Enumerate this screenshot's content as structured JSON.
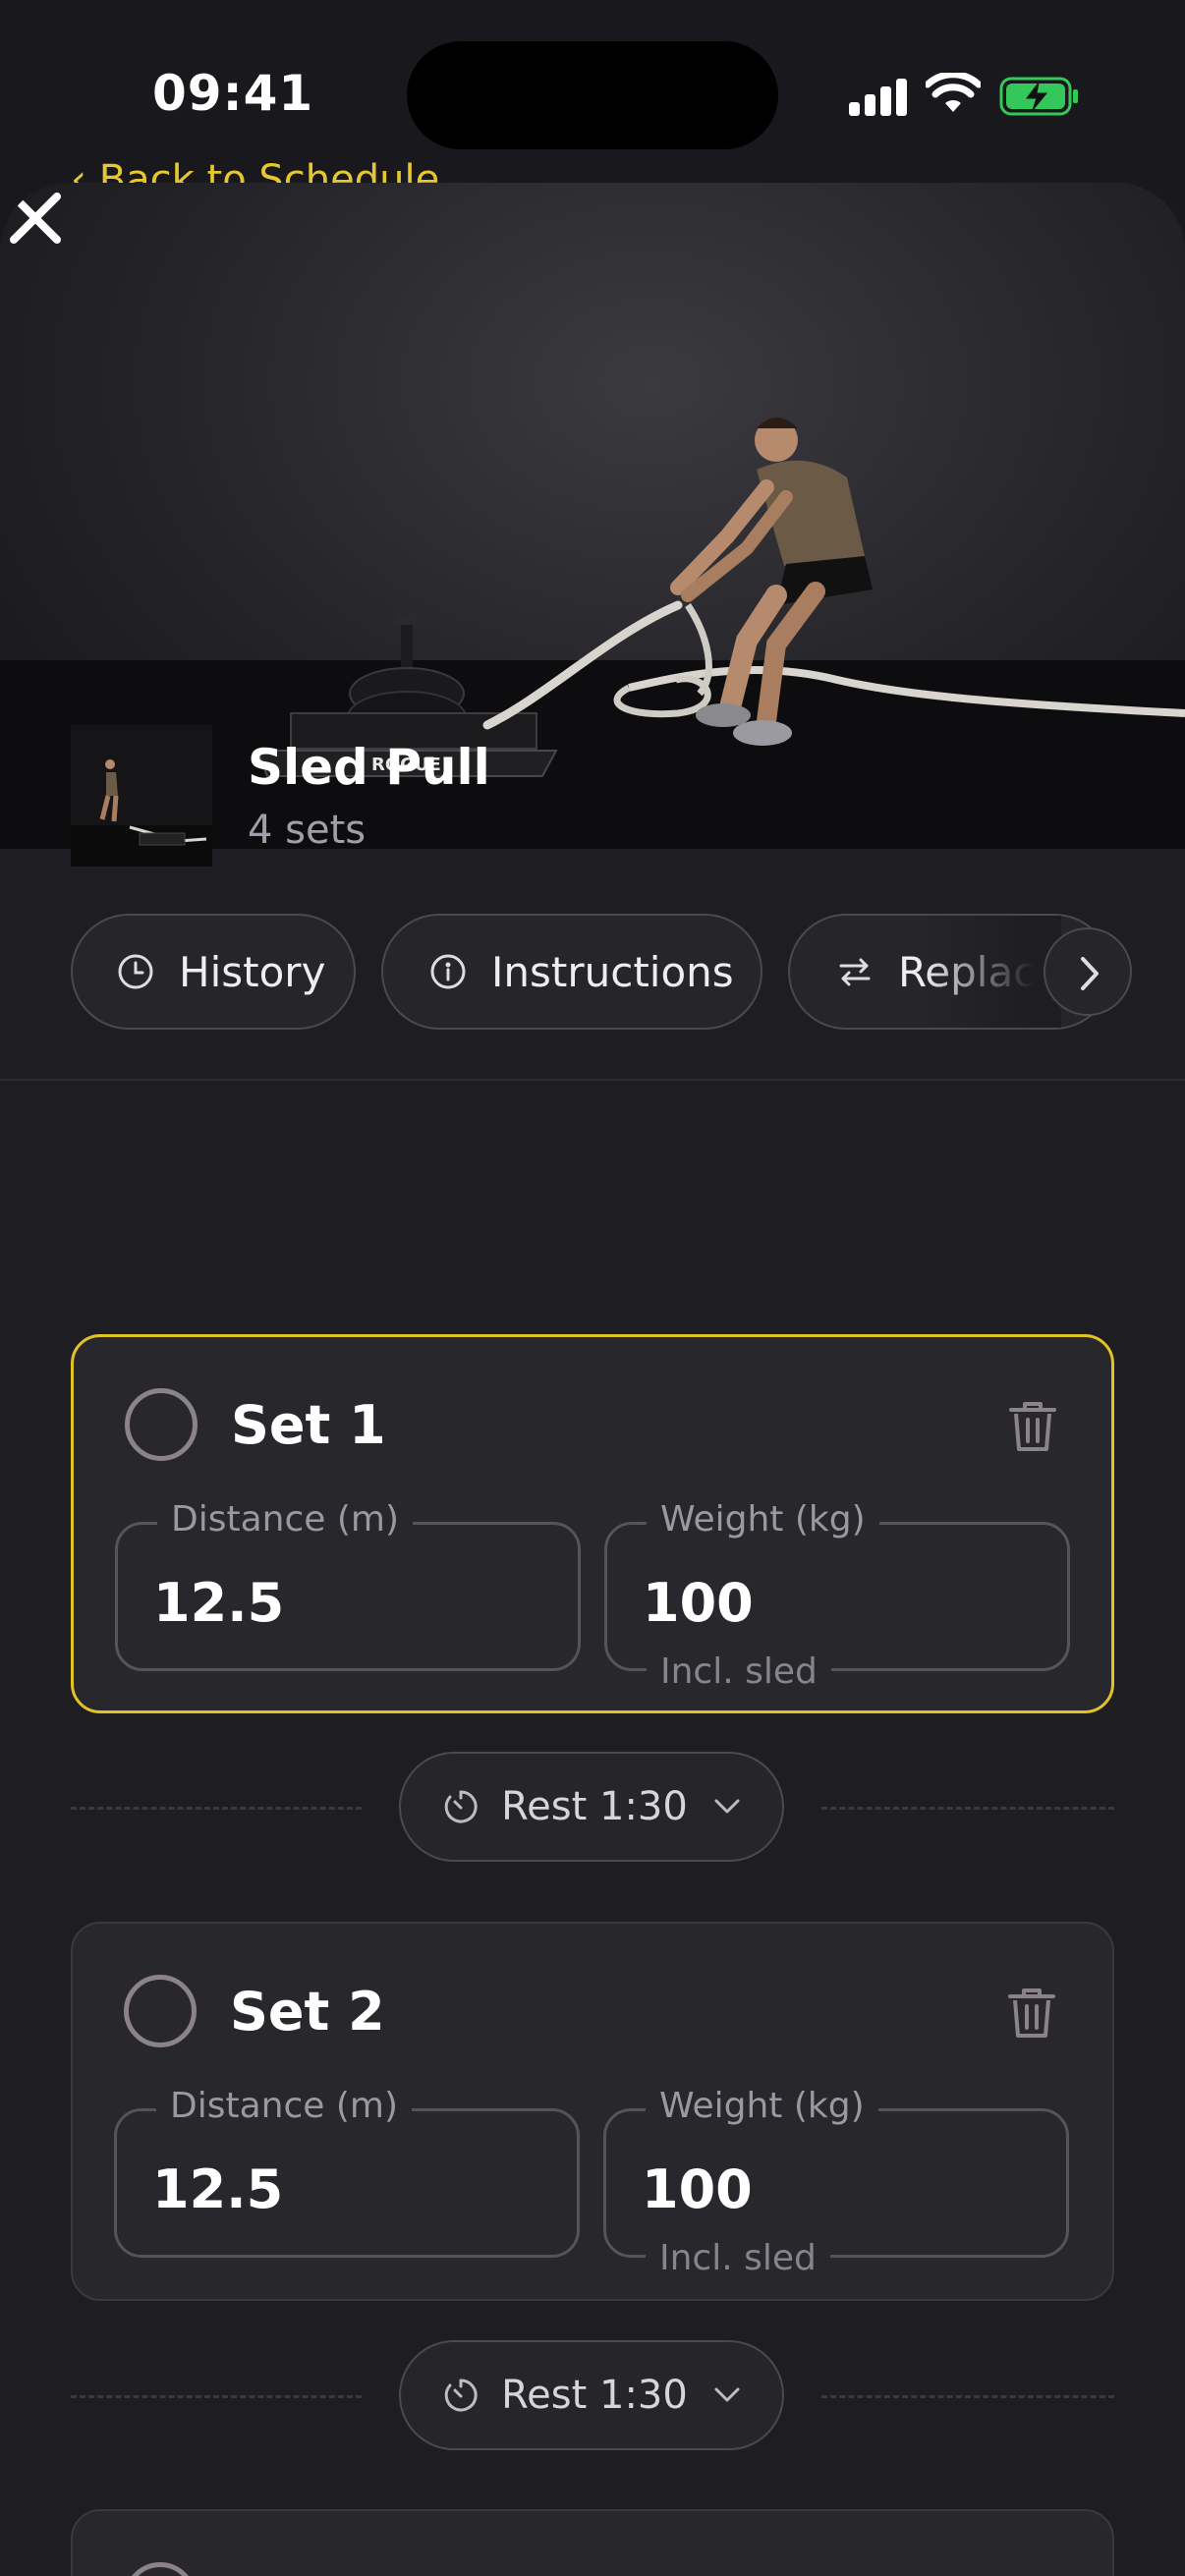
{
  "status_bar": {
    "time": "09:41"
  },
  "nav": {
    "back_label": "‹ Back to Schedule"
  },
  "hero": {
    "brand_on_sled": "ROGUE"
  },
  "exercise": {
    "title": "Sled Pull",
    "subtitle": "4 sets",
    "chips": [
      {
        "label": "History",
        "icon": "clock-icon"
      },
      {
        "label": "Instructions",
        "icon": "info-icon"
      },
      {
        "label": "Replace",
        "icon": "swap-icon"
      }
    ]
  },
  "sets": [
    {
      "label": "Set 1",
      "distance_label": "Distance (m)",
      "distance_value": "12.5",
      "weight_label": "Weight (kg)",
      "weight_value": "100",
      "weight_note": "Incl. sled"
    },
    {
      "label": "Set 2",
      "distance_label": "Distance (m)",
      "distance_value": "12.5",
      "weight_label": "Weight (kg)",
      "weight_value": "100",
      "weight_note": "Incl. sled"
    }
  ],
  "rests": [
    {
      "label": "Rest 1:30"
    },
    {
      "label": "Rest 1:30"
    }
  ],
  "colors": {
    "accent": "#e2c325",
    "background": "#1e1d22",
    "card": "#28272c",
    "battery": "#34c759"
  }
}
